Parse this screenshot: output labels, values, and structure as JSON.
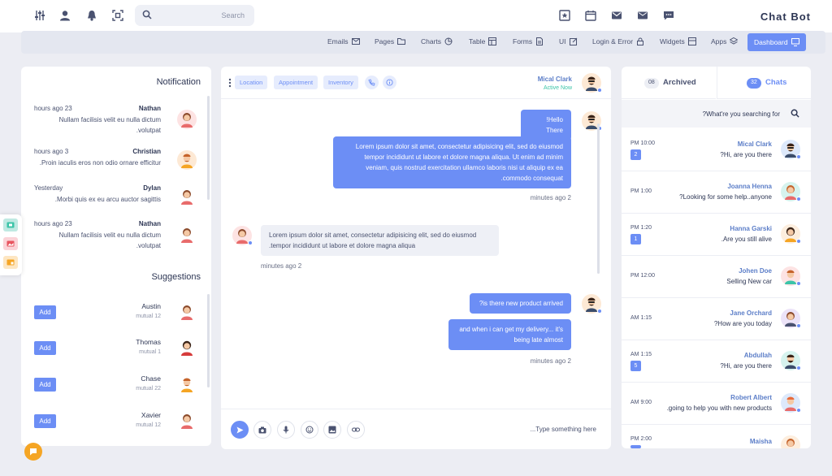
{
  "topbar": {
    "search_placeholder": "Search",
    "brand": "Chat Bot",
    "left_icons": [
      "sliders-icon",
      "user-icon",
      "bell-icon",
      "focus-icon"
    ],
    "right_icons": [
      "star-icon",
      "calendar-icon",
      "mail-check-icon",
      "mail-icon",
      "chat-icon"
    ]
  },
  "menu": {
    "items": [
      {
        "label": "Emails",
        "icon": "mail-icon"
      },
      {
        "label": "Pages",
        "icon": "folder-icon"
      },
      {
        "label": "Charts",
        "icon": "pie-chart-icon"
      },
      {
        "label": "Table",
        "icon": "table-icon"
      },
      {
        "label": "Forms",
        "icon": "form-icon"
      },
      {
        "label": "UI",
        "icon": "edit-icon"
      },
      {
        "label": "Login & Error",
        "icon": "lock-icon"
      },
      {
        "label": "Widgets",
        "icon": "widget-icon"
      },
      {
        "label": "Apps",
        "icon": "layers-icon"
      },
      {
        "label": "Dashboard",
        "icon": "monitor-icon",
        "active": true
      }
    ]
  },
  "notifications": {
    "title": "Notification",
    "items": [
      {
        "time": "hours ago 23",
        "name": "Nathan",
        "text": "Nullam facilisis velit eu nulla dictum .volutpat"
      },
      {
        "time": "hours ago 3",
        "name": "Christian",
        "text": ".Proin iaculis eros non odio ornare efficitur"
      },
      {
        "time": "Yesterday",
        "name": "Dylan",
        "text": ".Morbi quis ex eu arcu auctor sagittis"
      },
      {
        "time": "hours ago 23",
        "name": "Nathan",
        "text": "Nullam facilisis velit eu nulla dictum .volutpat"
      }
    ]
  },
  "suggestions": {
    "title": "Suggestions",
    "add_label": "Add",
    "items": [
      {
        "name": "Austin",
        "mutual": "mutual 12"
      },
      {
        "name": "Thomas",
        "mutual": "mutual 1"
      },
      {
        "name": "Chase",
        "mutual": "mutual 22"
      },
      {
        "name": "Xavier",
        "mutual": "mutual 12"
      }
    ]
  },
  "chat": {
    "chips": [
      "Location",
      "Appointment",
      "Inventory"
    ],
    "contact_name": "Mical Clark",
    "contact_status": "Active Now",
    "messages": [
      {
        "dir": "out",
        "text": "!Hello There"
      },
      {
        "dir": "out",
        "text": "Lorem ipsum dolor sit amet, consectetur adipisicing elit, sed do eiusmod tempor incididunt ut labore et dolore magna aliqua. Ut enim ad minim veniam, quis nostrud exercitation ullamco laboris nisi ut aliquip ex ea .commodo consequat"
      },
      {
        "dir": "in",
        "text": "Lorem ipsum dolor sit amet, consectetur adipisicing elit, sed do eiusmod .tempor incididunt ut labore et dolore magna aliqua"
      },
      {
        "dir": "out",
        "text": "?is there new product arrived"
      },
      {
        "dir": "out",
        "text": "and when i can get my delivery... it's being late almost"
      }
    ],
    "times": [
      "minutes ago 2",
      "minutes ago 2",
      "minutes ago 2"
    ],
    "input_placeholder": "...Type something here"
  },
  "right": {
    "tabs": [
      {
        "count": "08",
        "label": "Archived"
      },
      {
        "count": "32",
        "label": "Chats",
        "active": true
      }
    ],
    "search_placeholder": "?What're you searching for",
    "chats": [
      {
        "time": "PM 10:00",
        "badge": "2",
        "name": "Mical Clark",
        "msg": "?Hi, are you there"
      },
      {
        "time": "PM 1:00",
        "badge": "",
        "name": "Joanna Henna",
        "msg": "?Looking for some help..anyone"
      },
      {
        "time": "PM 1:20",
        "badge": "1",
        "name": "Hanna Garski",
        "msg": ".Are you still alive"
      },
      {
        "time": "PM 12:00",
        "badge": "",
        "name": "Johen Doe",
        "msg": "Selling New car"
      },
      {
        "time": "AM 1:15",
        "badge": "",
        "name": "Jane Orchard",
        "msg": "?How are you today"
      },
      {
        "time": "AM 1:15",
        "badge": "5",
        "name": "Abdullah",
        "msg": "?Hi, are you there"
      },
      {
        "time": "AM 9:00",
        "badge": "",
        "name": "Robert Albert",
        "msg": ".going to help you with new products"
      },
      {
        "time": "PM 2:00",
        "badge": "",
        "name": "Maisha",
        "msg": ""
      }
    ]
  },
  "colors": {
    "accent": "#6c8ef5",
    "online": "#3bc4a8",
    "fab": "#f5a524"
  }
}
